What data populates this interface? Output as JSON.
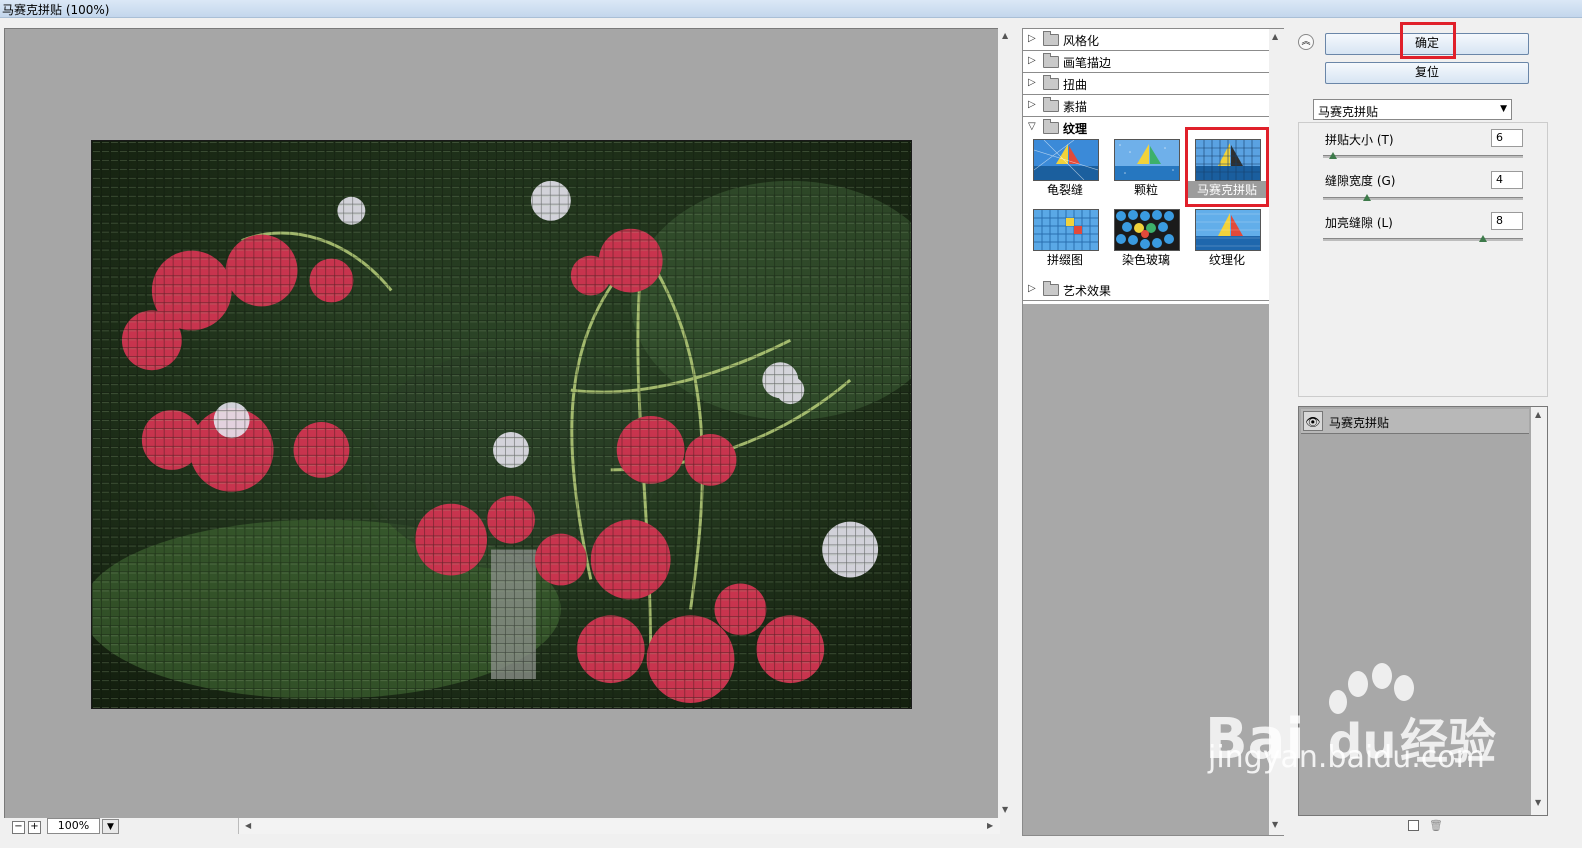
{
  "window": {
    "title": "马赛克拼贴 (100%)"
  },
  "zoom": {
    "value": "100%",
    "minus": "−",
    "plus": "+"
  },
  "gallery": {
    "categories": [
      {
        "label": "风格化",
        "open": false
      },
      {
        "label": "画笔描边",
        "open": false
      },
      {
        "label": "扭曲",
        "open": false
      },
      {
        "label": "素描",
        "open": false
      },
      {
        "label": "纹理",
        "open": true
      },
      {
        "label": "艺术效果",
        "open": false
      }
    ],
    "texture_filters": [
      {
        "label": "龟裂缝",
        "icon": "craquelure-thumb"
      },
      {
        "label": "颗粒",
        "icon": "grain-thumb"
      },
      {
        "label": "马赛克拼贴",
        "icon": "mosaic-tiles-thumb",
        "selected": true
      },
      {
        "label": "拼缀图",
        "icon": "patchwork-thumb"
      },
      {
        "label": "染色玻璃",
        "icon": "stained-glass-thumb"
      },
      {
        "label": "纹理化",
        "icon": "texturizer-thumb"
      }
    ]
  },
  "settings": {
    "ok_label": "确定",
    "reset_label": "复位",
    "filter_select": "马赛克拼贴",
    "params": [
      {
        "label": "拼贴大小 (T)",
        "value": "6",
        "fraction": 0.05
      },
      {
        "label": "缝隙宽度 (G)",
        "value": "4",
        "fraction": 0.22
      },
      {
        "label": "加亮缝隙 (L)",
        "value": "8",
        "fraction": 0.8
      }
    ]
  },
  "layers": {
    "items": [
      {
        "label": "马赛克拼贴"
      }
    ]
  },
  "watermark": {
    "text": "jingyan.baidu.com",
    "brand": "Bai du 经验"
  },
  "colors": {
    "highlight": "#e0202a",
    "gallery_bg": "#a8a8a8"
  }
}
